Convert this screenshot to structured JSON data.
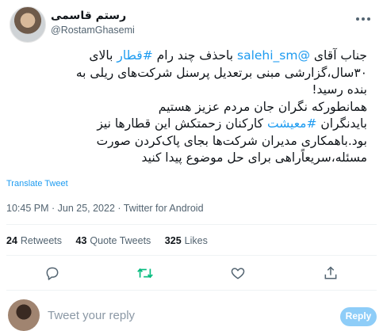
{
  "author": {
    "name": "رستم قاسمی",
    "handle": "@RostamGhasemi"
  },
  "tweet": {
    "lines": [
      [
        {
          "t": "جناب آقای "
        },
        {
          "t": "@salehi_sm",
          "link": true
        },
        {
          "t": " باحذف چند رام "
        },
        {
          "t": "#قطار",
          "link": true
        },
        {
          "t": " بالای"
        }
      ],
      [
        {
          "t": "۳۰سال،گزارشی مبنی برتعدیل پرسنل شرکت‌های ریلی به"
        }
      ],
      [
        {
          "t": "بنده رسید!"
        }
      ],
      [
        {
          "t": "همانطورکه نگران جان مردم عزیز هستیم"
        }
      ],
      [
        {
          "t": "بایدنگران "
        },
        {
          "t": "#معیشت",
          "link": true
        },
        {
          "t": " کارکنان زحمتکش این قطارها نیز"
        }
      ],
      [
        {
          "t": "بود.باهمکاری مدیران شرکت‌ها بجای پاک‌کردن صورت"
        }
      ],
      [
        {
          "t": "مسئله،سریعاًراهی برای حل موضوع پیدا کنید"
        }
      ]
    ],
    "translate_label": "Translate Tweet",
    "meta": "10:45 PM · Jun 25, 2022 · Twitter for Android"
  },
  "stats": {
    "retweets_count": "24",
    "retweets_label": "Retweets",
    "quotes_count": "43",
    "quotes_label": "Quote Tweets",
    "likes_count": "325",
    "likes_label": "Likes"
  },
  "reply": {
    "placeholder": "Tweet your reply",
    "button_label": "Reply"
  },
  "colors": {
    "accent": "#1d9bf0",
    "retweet_active": "#00ba7c",
    "muted": "#536471"
  },
  "icons": [
    "more-icon",
    "reply-icon",
    "retweet-icon",
    "like-icon",
    "share-icon"
  ]
}
